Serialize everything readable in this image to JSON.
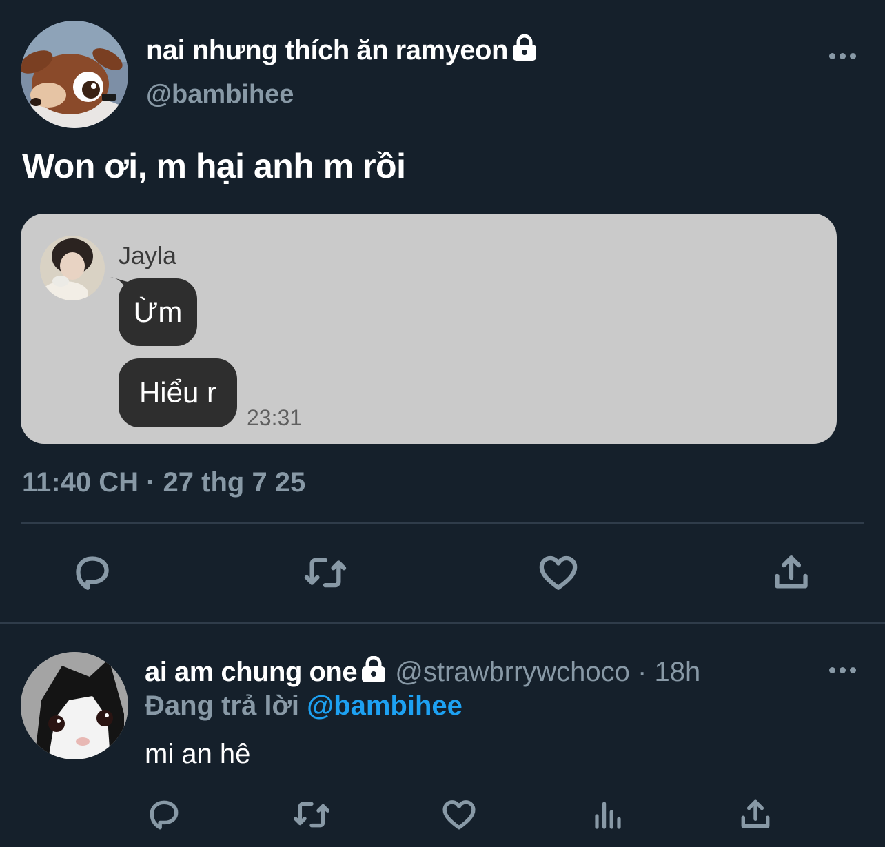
{
  "tweet": {
    "display_name": "nai nhưng thích ăn ramyeon",
    "handle": "@bambihee",
    "text": "Won ơi, m hại anh m rồi",
    "timestamp": "11:40 CH · 27 thg 7 25",
    "embed": {
      "sender": "Jayla",
      "messages": [
        "Ừm",
        "Hiểu r"
      ],
      "time": "23:31"
    },
    "actions": [
      "reply-icon",
      "retweet-icon",
      "like-icon",
      "share-icon"
    ]
  },
  "reply": {
    "display_name": "ai am chung one",
    "handle": "@strawbrrywchoco",
    "age": "18h",
    "replying_label": "Đang trả lời",
    "replying_to": "@bambihee",
    "text": "mi an hê",
    "actions": [
      "reply-icon",
      "retweet-icon",
      "like-icon",
      "analytics-icon",
      "share-icon"
    ]
  },
  "colors": {
    "background": "#15202b",
    "secondary_text": "#8899a6",
    "link": "#1da1f2",
    "embed_bg": "#cacaca",
    "bubble": "#2e2e2e"
  }
}
